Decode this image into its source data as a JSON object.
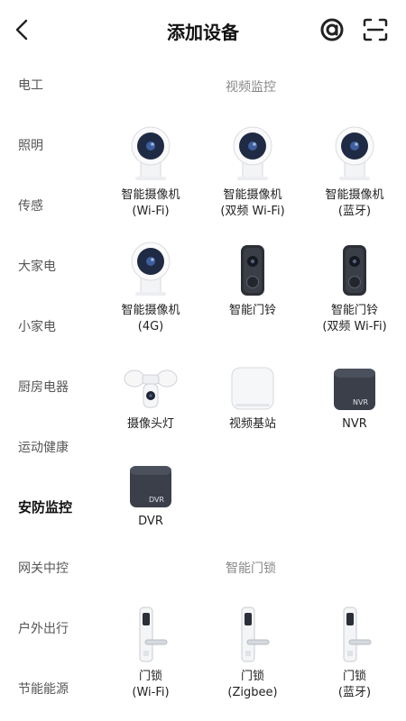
{
  "header": {
    "title": "添加设备",
    "back_icon": "chevron-left-icon",
    "at_icon": "at-sign-icon",
    "scan_icon": "scan-icon"
  },
  "sidebar": {
    "items": [
      {
        "label": "电工"
      },
      {
        "label": "照明"
      },
      {
        "label": "传感"
      },
      {
        "label": "大家电"
      },
      {
        "label": "小家电"
      },
      {
        "label": "厨房电器"
      },
      {
        "label": "运动健康"
      },
      {
        "label": "安防监控",
        "active": true
      },
      {
        "label": "网关中控"
      },
      {
        "label": "户外出行"
      },
      {
        "label": "节能能源"
      }
    ]
  },
  "sections": [
    {
      "title": "视频监控",
      "devices": [
        {
          "line1": "智能摄像机",
          "line2": "(Wi-Fi)",
          "icon": "camera-icon"
        },
        {
          "line1": "智能摄像机",
          "line2": "(双频 Wi-Fi)",
          "icon": "camera-icon"
        },
        {
          "line1": "智能摄像机",
          "line2": "(蓝牙)",
          "icon": "camera-icon"
        },
        {
          "line1": "智能摄像机",
          "line2": "(4G)",
          "icon": "camera-icon"
        },
        {
          "line1": "智能门铃",
          "line2": "",
          "icon": "doorbell-icon"
        },
        {
          "line1": "智能门铃",
          "line2": "(双频 Wi-Fi)",
          "icon": "doorbell-icon"
        },
        {
          "line1": "摄像头灯",
          "line2": "",
          "icon": "floodlight-camera-icon"
        },
        {
          "line1": "视频基站",
          "line2": "",
          "icon": "base-station-icon"
        },
        {
          "line1": "NVR",
          "line2": "",
          "icon": "nvr-icon",
          "badge": "NVR"
        },
        {
          "line1": "DVR",
          "line2": "",
          "icon": "dvr-icon",
          "badge": "DVR"
        }
      ]
    },
    {
      "title": "智能门锁",
      "devices": [
        {
          "line1": "门锁",
          "line2": "(Wi-Fi)",
          "icon": "door-lock-icon"
        },
        {
          "line1": "门锁",
          "line2": "(Zigbee)",
          "icon": "door-lock-icon"
        },
        {
          "line1": "门锁",
          "line2": "(蓝牙)",
          "icon": "door-lock-icon"
        }
      ]
    }
  ],
  "colors": {
    "accent_dark": "#3a3f4a",
    "camera_lens": "#1f2a44",
    "text_muted": "#888888"
  }
}
